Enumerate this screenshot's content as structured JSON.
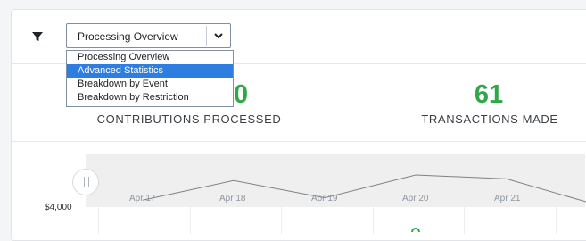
{
  "filter": {
    "selected": "Processing Overview",
    "options": [
      "Processing Overview",
      "Advanced Statistics",
      "Breakdown by Event",
      "Breakdown by Restriction"
    ],
    "highlighted": "Advanced Statistics"
  },
  "stats": [
    {
      "value": "00",
      "label": "CONTRIBUTIONS PROCESSED"
    },
    {
      "value": "61",
      "label": "TRANSACTIONS MADE"
    }
  ],
  "chart": {
    "navigator_ticks": [
      "Apr 17",
      "Apr 18",
      "Apr 19",
      "Apr 20",
      "Apr 21"
    ],
    "y_label": "$4,000",
    "navigator_series": [
      2,
      27,
      5,
      34,
      29,
      0
    ]
  },
  "colors": {
    "accent_green": "#2ea84a",
    "highlight_blue": "#2d7ee0"
  }
}
